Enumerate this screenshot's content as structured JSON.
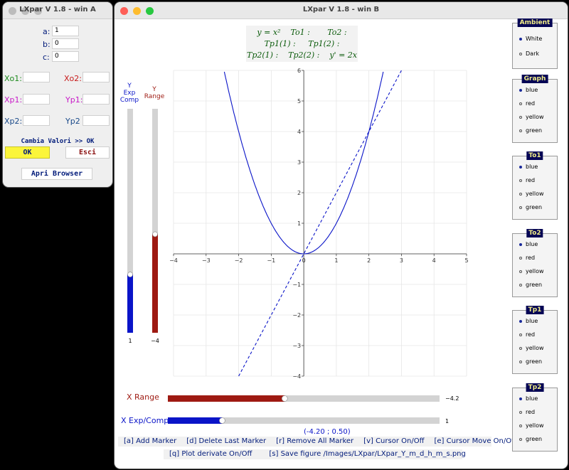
{
  "winA": {
    "title": "LXpar V 1.8 - win A",
    "fields": [
      {
        "label": "a:",
        "value": "1"
      },
      {
        "label": "b:",
        "value": "0"
      },
      {
        "label": "c:",
        "value": "0"
      }
    ],
    "points": {
      "xo1": {
        "label": "Xo1:",
        "value": ""
      },
      "xo2": {
        "label": "Xo2:",
        "value": ""
      },
      "xp1": {
        "label": "Xp1:",
        "value": ""
      },
      "yp1": {
        "label": "Yp1:",
        "value": ""
      },
      "xp2": {
        "label": "Xp2:",
        "value": ""
      },
      "yp2": {
        "label": "Yp2",
        "value": ""
      }
    },
    "cambia": "Cambia Valori >> OK",
    "ok": "OK",
    "esci": "Esci",
    "apri": "Apri Browser"
  },
  "winB": {
    "title": "LXpar V 1.8 - win B",
    "legend": {
      "line1a": "y = x²",
      "line1b": "To1 :",
      "line1c": "To2 :",
      "line2a": "Tp1(1) :",
      "line2b": "Tp1(2) :",
      "line3a": "Tp2(1) :",
      "line3b": "Tp2(2) :",
      "line3c": "y' = 2x"
    },
    "y_exp": {
      "label": "Y\nExp\nComp",
      "value_label": "1",
      "fraction": 0.26
    },
    "y_range": {
      "label": "Y\nRange",
      "value_label": "−4",
      "fraction": 0.44
    },
    "x_range": {
      "label": "X Range",
      "value_label": "−4.2",
      "fraction": 0.43
    },
    "x_exp": {
      "label": "X Exp/Comp",
      "value_label": "1",
      "fraction": 0.2
    },
    "cursor": "(-4.20 ; 0.50)",
    "commands1": [
      "[a] Add Marker",
      "[d] Delete Last Marker",
      "[r] Remove All Marker",
      "[v] Cursor On/Off",
      "[e] Cursor Move On/Off"
    ],
    "commands2": [
      "[q] Plot derivate On/Off",
      "[s] Save figure /Images/LXpar/LXpar_Y_m_d_h_m_s.png"
    ],
    "panels": [
      {
        "title": "Ambient",
        "options": [
          "White",
          "Dark"
        ],
        "selected": 0
      },
      {
        "title": "Graph",
        "options": [
          "blue",
          "red",
          "yellow",
          "green"
        ],
        "selected": 0
      },
      {
        "title": "To1",
        "options": [
          "blue",
          "red",
          "yellow",
          "green"
        ],
        "selected": 0
      },
      {
        "title": "To2",
        "options": [
          "blue",
          "red",
          "yellow",
          "green"
        ],
        "selected": 0
      },
      {
        "title": "Tp1",
        "options": [
          "blue",
          "red",
          "yellow",
          "green"
        ],
        "selected": 0
      },
      {
        "title": "Tp2",
        "options": [
          "blue",
          "red",
          "yellow",
          "green"
        ],
        "selected": 0
      }
    ]
  },
  "colors": {
    "accent_blue": "#0a14c8",
    "dark_red": "#9e1a12",
    "ok_yellow": "#fbf53a"
  },
  "chart_data": {
    "type": "line",
    "xlim": [
      -4,
      5
    ],
    "ylim": [
      -4,
      6
    ],
    "x_ticks": [
      "−4",
      "−3",
      "−2",
      "−1",
      "0",
      "1",
      "2",
      "3",
      "4",
      "5"
    ],
    "y_ticks": [
      "−4",
      "−3",
      "−2",
      "−1",
      "0",
      "1",
      "2",
      "3",
      "4",
      "5",
      "6"
    ],
    "grid": true,
    "series": [
      {
        "expr": "x^2",
        "style": "solid",
        "color": "#0a14c8"
      },
      {
        "expr": "2x",
        "style": "dashed",
        "color": "#0a14c8"
      }
    ]
  }
}
